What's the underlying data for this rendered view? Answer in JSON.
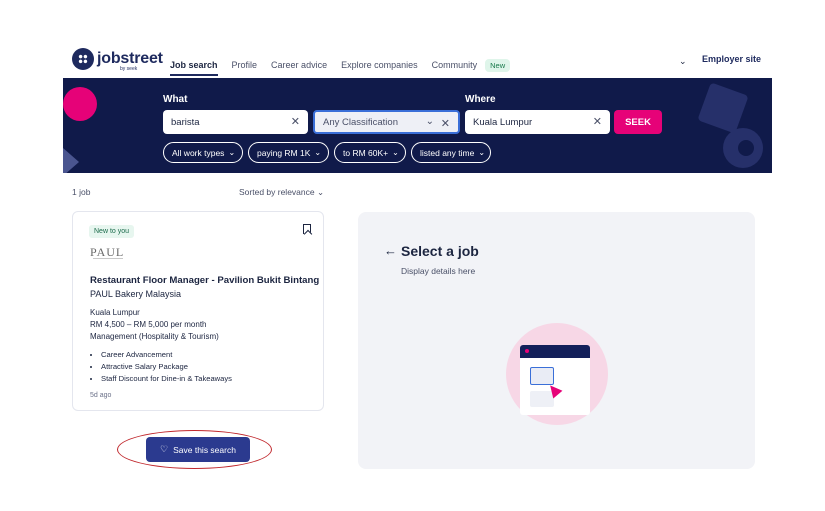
{
  "header": {
    "logo_text": "jobstreet",
    "logo_sub": "by seek",
    "nav": [
      {
        "label": "Job search"
      },
      {
        "label": "Profile"
      },
      {
        "label": "Career advice"
      },
      {
        "label": "Explore companies"
      },
      {
        "label": "Community"
      }
    ],
    "new_badge": "New",
    "employer_link": "Employer site"
  },
  "search": {
    "what_label": "What",
    "where_label": "Where",
    "keyword_value": "barista",
    "classification_placeholder": "Any Classification",
    "location_value": "Kuala Lumpur",
    "seek_label": "SEEK",
    "filters": [
      {
        "label": "All work types"
      },
      {
        "label": "paying RM 1K"
      },
      {
        "label": "to RM 60K+"
      },
      {
        "label": "listed any time"
      }
    ]
  },
  "results": {
    "count": "1 job",
    "sort": "Sorted by relevance"
  },
  "job_card": {
    "badge": "New to you",
    "brand_text": "PAUL",
    "title": "Restaurant Floor Manager - Pavilion Bukit Bintang",
    "company": "PAUL Bakery Malaysia",
    "location": "Kuala Lumpur",
    "salary": "RM 4,500 – RM 5,000 per month",
    "category": "Management (Hospitality & Tourism)",
    "bullets": [
      "Career Advancement",
      "Attractive Salary Package",
      "Staff Discount for Dine-in & Takeaways"
    ],
    "posted": "5d ago"
  },
  "save_search_label": "Save this search",
  "detail_panel": {
    "title": "Select a job",
    "subtitle": "Display details here"
  },
  "colors": {
    "brand_navy": "#101a4a",
    "brand_pink": "#e60278",
    "button_blue": "#2b3a8f",
    "annotation_red": "#c0282d"
  }
}
